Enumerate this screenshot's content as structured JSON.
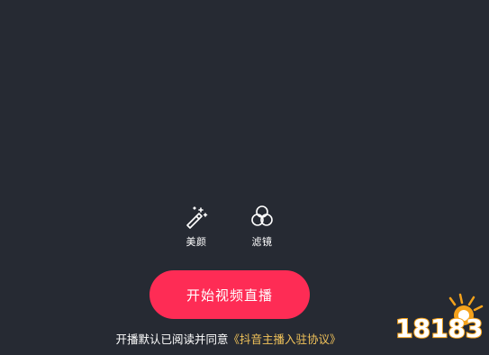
{
  "tools": {
    "beauty": {
      "label": "美颜",
      "icon": "magic-wand-icon"
    },
    "filter": {
      "label": "滤镜",
      "icon": "filter-circles-icon"
    }
  },
  "start_button": {
    "label": "开始视频直播"
  },
  "agreement": {
    "prefix": "开播默认已阅读并同意",
    "link": "《抖音主播入驻协议》"
  },
  "watermark": {
    "text": "18183"
  },
  "colors": {
    "background": "#262a33",
    "accent": "#fe2c55",
    "link": "#f2c35a",
    "watermark": "#f5a21b"
  }
}
